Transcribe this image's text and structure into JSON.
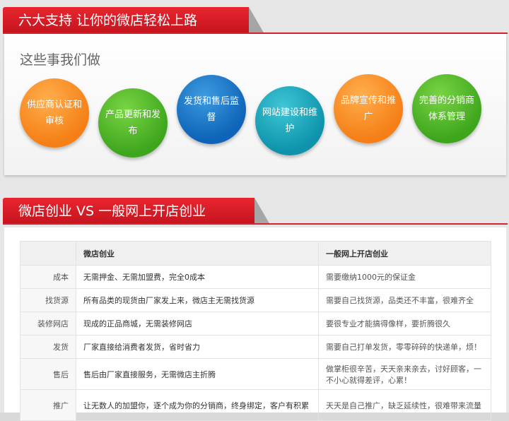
{
  "section1": {
    "title": "六大支持 让你的微店轻松上路",
    "subtitle": "这些事我们做",
    "items": [
      {
        "label": "供应商认证和审核",
        "color": "orange"
      },
      {
        "label": "产品更新和发布",
        "color": "green"
      },
      {
        "label": "发货和售后监督",
        "color": "blue"
      },
      {
        "label": "网站建设和维护",
        "color": "teal"
      },
      {
        "label": "品牌宣传和推广",
        "color": "orange"
      },
      {
        "label": "完善的分销商体系管理",
        "color": "green"
      }
    ]
  },
  "section2": {
    "title": "微店创业 VS 一般网上开店创业",
    "table": {
      "headers": [
        "",
        "微店创业",
        "一般网上开店创业"
      ],
      "rows": [
        {
          "label": "成本",
          "weidian": "无需押金、无需加盟费，完全0成本",
          "general": "需要缴纳1000元的保证金"
        },
        {
          "label": "找货源",
          "weidian": "所有品类的现货由厂家发上来，微店主无需找货源",
          "general": "需要自己找货源，品类还不丰富，很难齐全"
        },
        {
          "label": "装修网店",
          "weidian": "现成的正品商城，无需装修网店",
          "general": "要很专业才能搞得像样，要折腾很久"
        },
        {
          "label": "发货",
          "weidian": "厂家直接给消费者发货，省时省力",
          "general": "需要自己打单发货，零零碎碎的快递单，烦！"
        },
        {
          "label": "售后",
          "weidian": "售后由厂家直接服务，无需微店主折腾",
          "general": "做掌柜很辛苦，天天亲来亲去，讨好顾客，一不小心就得差评，心累！"
        },
        {
          "label": "推广",
          "weidian": "让无数人的加盟你，逐个成为你的分销商，终身绑定，客户有积累",
          "general": "天天是自己推广，缺乏延续性，很难带来流量"
        }
      ]
    }
  },
  "colors": {
    "banner_red": "#d8202a",
    "orange": "#f57f16",
    "green": "#3ea61d",
    "blue": "#0e64b8",
    "teal": "#0e93ab"
  }
}
